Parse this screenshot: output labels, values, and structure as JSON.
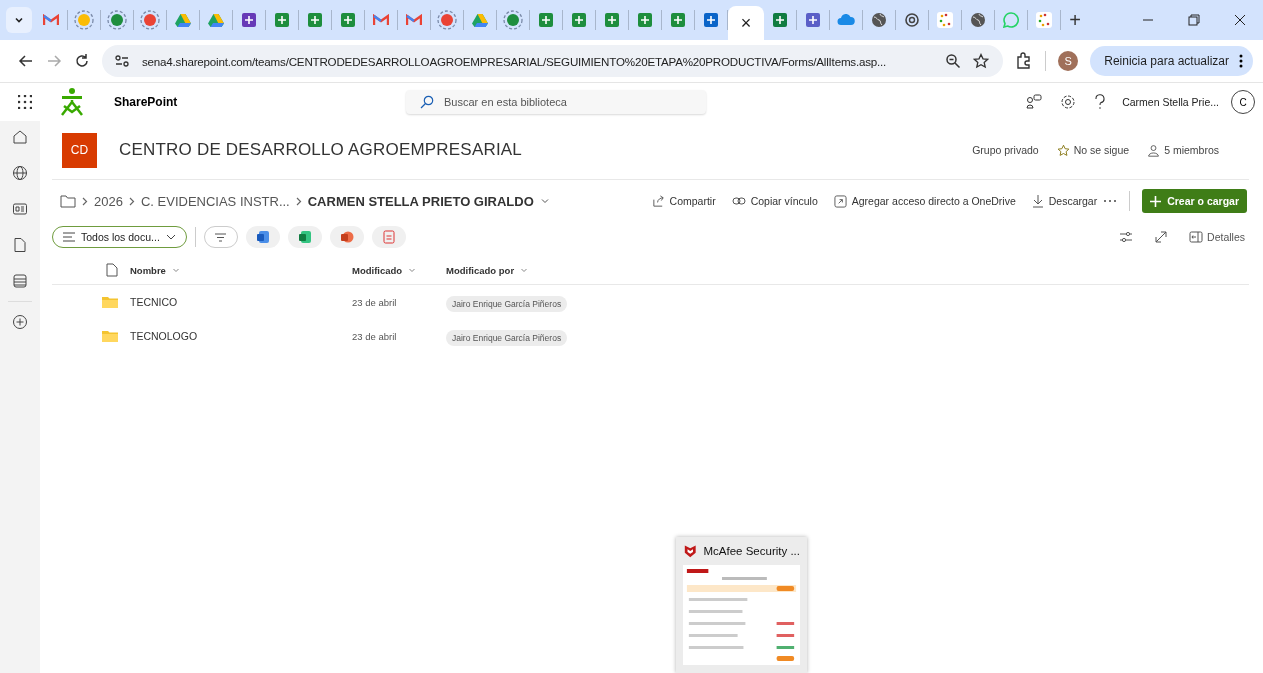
{
  "browser": {
    "tabs": [
      {
        "kind": "gmail",
        "selected": false
      },
      {
        "kind": "drive-ring",
        "selected": false
      },
      {
        "kind": "sheets-ring",
        "selected": false
      },
      {
        "kind": "gmail-ring",
        "selected": false
      },
      {
        "kind": "drive",
        "selected": false
      },
      {
        "kind": "drive",
        "selected": false
      },
      {
        "kind": "forms",
        "selected": false
      },
      {
        "kind": "sheets",
        "selected": false
      },
      {
        "kind": "sheets",
        "selected": false
      },
      {
        "kind": "sheets",
        "selected": false
      },
      {
        "kind": "gmail",
        "selected": false
      },
      {
        "kind": "gmail",
        "selected": false
      },
      {
        "kind": "gmail-ring",
        "selected": false
      },
      {
        "kind": "drive",
        "selected": false
      },
      {
        "kind": "sheets-ring",
        "selected": false
      },
      {
        "kind": "sheets",
        "selected": false
      },
      {
        "kind": "sheets",
        "selected": false
      },
      {
        "kind": "sheets",
        "selected": false
      },
      {
        "kind": "sheets",
        "selected": false
      },
      {
        "kind": "sheets",
        "selected": false
      },
      {
        "kind": "outlook",
        "selected": false
      },
      {
        "selected": true
      },
      {
        "kind": "excel",
        "selected": false
      },
      {
        "kind": "teams",
        "selected": false
      },
      {
        "kind": "onedrive",
        "selected": false
      },
      {
        "kind": "globe",
        "selected": false
      },
      {
        "kind": "chatgpt",
        "selected": false
      },
      {
        "kind": "loader",
        "selected": false
      },
      {
        "kind": "globe",
        "selected": false
      },
      {
        "kind": "whatsapp",
        "selected": false
      },
      {
        "kind": "loader",
        "selected": false
      }
    ],
    "close_tab": "×",
    "new_tab": "+",
    "url": "sena4.sharepoint.com/teams/CENTRODEDESARROLLOAGROEMPRESARIAL/SEGUIMIENTO%20ETAPA%20PRODUCTIVA/Forms/AllItems.asp...",
    "profile_initial": "S",
    "update_button": "Reinicia para actualizar"
  },
  "app": {
    "name": "SharePoint",
    "search_placeholder": "Buscar en esta biblioteca",
    "user_name": "Carmen Stella Prie...",
    "user_initial": "C"
  },
  "site": {
    "initials": "CD",
    "title": "CENTRO DE DESARROLLO AGROEMPRESARIAL",
    "privacy": "Grupo privado",
    "follow": "No se sigue",
    "members": "5 miembros"
  },
  "breadcrumb": [
    {
      "label": "2026",
      "current": false
    },
    {
      "label": "C. EVIDENCIAS INSTR...",
      "current": false
    },
    {
      "label": "CARMEN STELLA PRIETO GIRALDO",
      "current": true
    }
  ],
  "commands": [
    {
      "kind": "share",
      "label": "Compartir"
    },
    {
      "kind": "link",
      "label": "Copiar vínculo"
    },
    {
      "kind": "shortcut",
      "label": "Agregar acceso directo a OneDrive"
    },
    {
      "kind": "download",
      "label": "Descargar"
    }
  ],
  "create_button": "Crear o cargar",
  "view": {
    "name": "Todos los docu...",
    "details": "Detalles"
  },
  "table": {
    "columns": [
      "Nombre",
      "Modificado",
      "Modificado por"
    ],
    "rows": [
      {
        "name": "TECNICO",
        "modified": "23 de abril",
        "modified_by": "Jairo Enrique García Piñeros"
      },
      {
        "name": "TECNOLOGO",
        "modified": "23 de abril",
        "modified_by": "Jairo Enrique García Piñeros"
      }
    ]
  },
  "taskbar_preview": {
    "title": "McAfee Security ...",
    "kind": "picture"
  }
}
